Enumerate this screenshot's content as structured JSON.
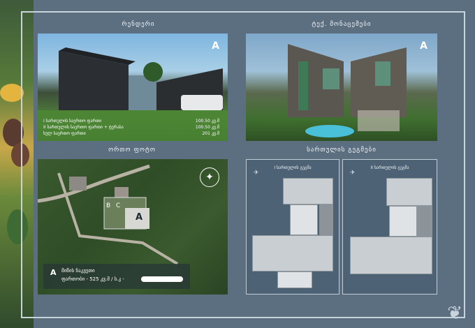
{
  "sections": {
    "renders": "რენდერი",
    "photos": "ტექ. მონაცემები",
    "map": "ორთო ფოტო",
    "plans": "სართულის გეგმები"
  },
  "badge_letter": "A",
  "render_info": [
    {
      "label": "I სართულის საერთო ფართი",
      "value": "100.50 კვ.მ"
    },
    {
      "label": "II სართულის საერთო ფართი + ტერასა",
      "value": "100.50 კვ.მ"
    },
    {
      "label": "სულ საერთო ფართი",
      "value": "201 კვ.მ"
    }
  ],
  "map": {
    "plot_letters": [
      "B",
      "C",
      "A"
    ],
    "info_letter": "A",
    "info_title": "მიწის ნაკვეთი",
    "info_detail": "ფართობი - 525 კვ.მ / ს.კ -"
  },
  "plans": {
    "floor1": "I სართულის გეგმა",
    "floor2": "II სართულის გეგმა"
  },
  "colors": {
    "background": "#5c6f80",
    "frame": "#c9d3dc",
    "card": "#4d6275"
  }
}
